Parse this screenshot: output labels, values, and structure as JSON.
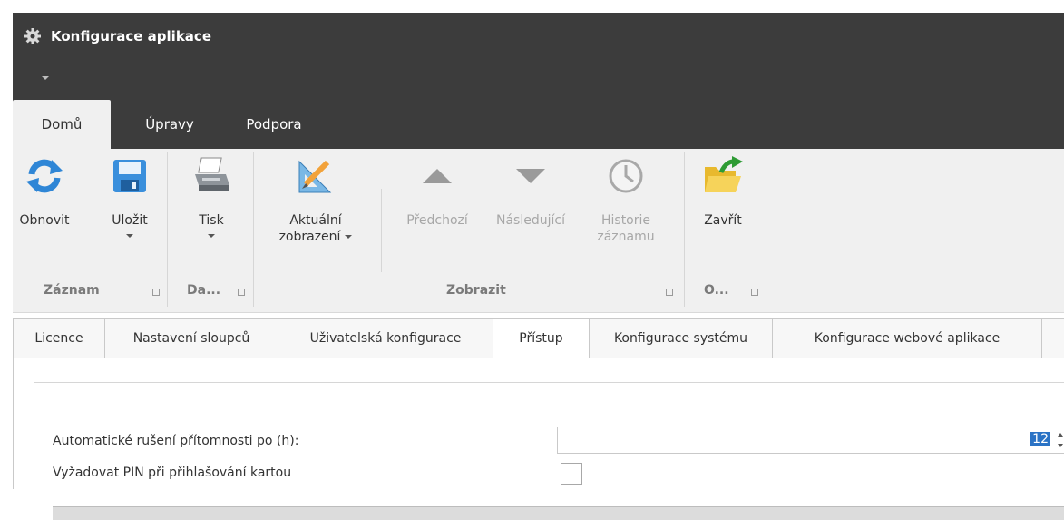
{
  "window": {
    "title": "Konfigurace aplikace",
    "icon": "gear-icon"
  },
  "ribbon_tabs": [
    "Domů",
    "Úpravy",
    "Podpora"
  ],
  "ribbon": {
    "buttons": {
      "refresh": "Obnovit",
      "save": "Uložit",
      "print": "Tisk",
      "current_view_line1": "Aktuální",
      "current_view_line2": "zobrazení",
      "previous": "Předchozí",
      "next": "Následující",
      "history_line1": "Historie",
      "history_line2": "záznamu",
      "close": "Zavřít"
    },
    "groups": {
      "record": "Záznam",
      "data": "Da...",
      "view": "Zobrazit",
      "other": "O..."
    }
  },
  "page_tabs": [
    "Licence",
    "Nastavení sloupců",
    "Uživatelská konfigurace",
    "Přístup",
    "Konfigurace systému",
    "Konfigurace webové aplikace"
  ],
  "active_page_tab": "Přístup",
  "form": {
    "auto_cancel_label": "Automatické rušení přítomnosti po (h):",
    "auto_cancel_value": "12",
    "require_pin_label": "Vyžadovat PIN při přihlašování kartou",
    "require_pin_checked": false
  },
  "colors": {
    "titlebar": "#3c3c3c",
    "ribbon_bg": "#f0f0f0",
    "selection": "#2b73c5"
  }
}
